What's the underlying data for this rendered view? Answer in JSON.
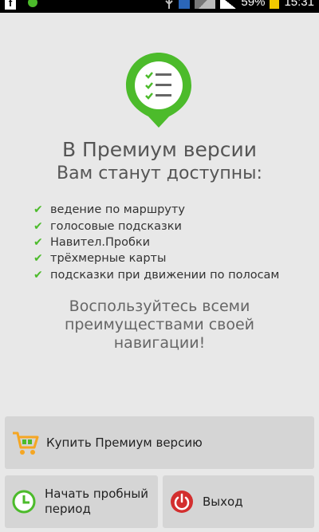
{
  "status_bar": {
    "battery": "59%",
    "time": "15:31"
  },
  "header": {
    "title_line1": "В Премиум версии",
    "title_line2": "Вам станут доступны:"
  },
  "features": [
    "ведение по маршруту",
    "голосовые подсказки",
    "Навител.Пробки",
    "трёхмерные карты",
    "подсказки при движении по полосам"
  ],
  "promo": {
    "line1": "Воспользуйтесь всеми",
    "line2": "преимуществами своей",
    "line3": "навигации!"
  },
  "buttons": {
    "buy_label": "Купить Премиум версию",
    "trial_line1": "Начать пробный",
    "trial_line2": "период",
    "exit_label": "Выход"
  },
  "colors": {
    "accent_green": "#4cbb2b",
    "exit_red": "#d32f2f",
    "cart_orange": "#f5a623",
    "button_bg": "#d5d5d5"
  },
  "icons": {
    "app_pin": "checklist-pin-icon",
    "buy": "shopping-cart-icon",
    "trial": "clock-icon",
    "exit": "power-icon"
  }
}
